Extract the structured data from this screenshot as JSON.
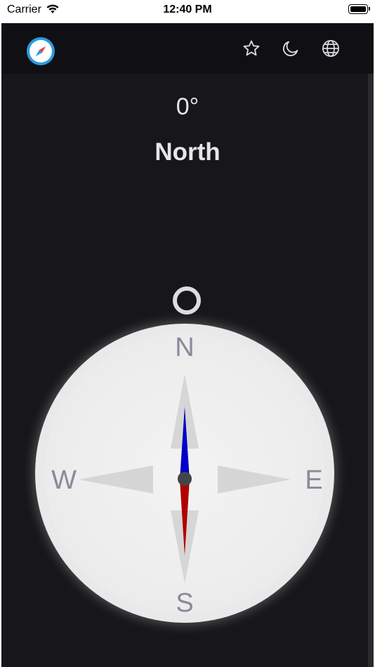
{
  "status_bar": {
    "carrier": "Carrier",
    "time": "12:40 PM"
  },
  "toolbar": {
    "icons": [
      "compass-logo-icon",
      "star-icon",
      "moon-icon",
      "globe-icon"
    ]
  },
  "heading": {
    "degrees": "0°",
    "direction": "North"
  },
  "compass": {
    "cardinals": {
      "n": "N",
      "e": "E",
      "s": "S",
      "w": "W"
    },
    "needle_north_color": "#0000c8",
    "needle_south_color": "#b00000",
    "dial_color": "#e8e8e8",
    "background_color": "#17171b"
  }
}
